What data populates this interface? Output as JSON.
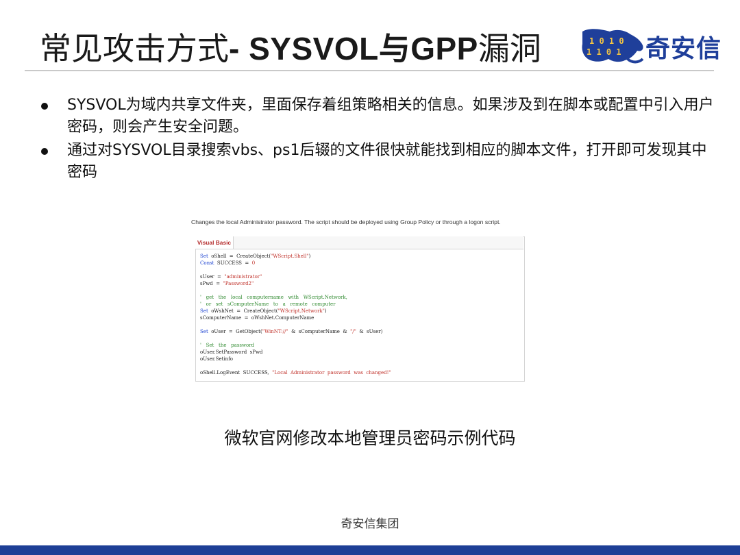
{
  "slide": {
    "title_cn": "常见攻击方式",
    "title_en": "- SYSVOL与GPP",
    "title_cn2": "漏洞",
    "logo_text": "奇安信",
    "bullets": [
      "SYSVOL为域内共享文件夹，里面保存着组策略相关的信息。如果涉及到在脚本或配置中引入用户密码，则会产生安全问题。",
      "通过对SYSVOL目录搜索vbs、ps1后辍的文件很快就能找到相应的脚本文件，打开即可发现其中密码"
    ],
    "figure_caption": "微软官网修改本地管理员密码示例代码",
    "footer": "奇安信集团"
  },
  "code_sample": {
    "caption": "Changes the local Administrator password. The script should be deployed using Group Policy or through a logon script.",
    "tab_label": "Visual Basic",
    "lines": [
      [
        [
          "kw",
          "Set"
        ],
        [
          "",
          "  oShell  =  CreateObject("
        ],
        [
          "str",
          "\"WScript.Shell\""
        ],
        [
          "",
          ")"
        ]
      ],
      [
        [
          "kw",
          "Const"
        ],
        [
          "",
          "  SUCCESS  =  "
        ],
        [
          "str",
          "0"
        ]
      ],
      [
        [
          "",
          ""
        ]
      ],
      [
        [
          "",
          "sUser  =  "
        ],
        [
          "str",
          "\"administrator\""
        ]
      ],
      [
        [
          "",
          "sPwd  =  "
        ],
        [
          "str",
          "\"Password2\""
        ]
      ],
      [
        [
          "",
          ""
        ]
      ],
      [
        [
          "cm",
          "'   get   the   local   computername   with   WScript.Network,"
        ]
      ],
      [
        [
          "cm",
          "'   or   set   sComputerName   to   a   remote   computer"
        ]
      ],
      [
        [
          "kw",
          "Set"
        ],
        [
          "",
          "  oWshNet  =  CreateObject("
        ],
        [
          "str",
          "\"WScript.Network\""
        ],
        [
          "",
          ")"
        ]
      ],
      [
        [
          "",
          "sComputerName  =  oWshNet.ComputerName"
        ]
      ],
      [
        [
          "",
          ""
        ]
      ],
      [
        [
          "kw",
          "Set"
        ],
        [
          "",
          "  oUser  =  GetObject("
        ],
        [
          "str",
          "\"WinNT://\""
        ],
        [
          "",
          "  &  sComputerName  &  "
        ],
        [
          "str",
          "\"/\""
        ],
        [
          "",
          "  &  sUser)"
        ]
      ],
      [
        [
          "",
          ""
        ]
      ],
      [
        [
          "cm",
          "'   Set   the   password"
        ]
      ],
      [
        [
          "",
          "oUser.SetPassword  sPwd"
        ]
      ],
      [
        [
          "",
          "oUser.Setinfo"
        ]
      ],
      [
        [
          "",
          ""
        ]
      ],
      [
        [
          "",
          "oShell.LogEvent  SUCCESS,  "
        ],
        [
          "str",
          "\"Local  Administrator  password  was  changed!\""
        ]
      ]
    ]
  },
  "colors": {
    "accent_blue": "#1e3f96",
    "keyword": "#1a40d0",
    "string": "#c0312a",
    "comment": "#2f8a2f"
  }
}
